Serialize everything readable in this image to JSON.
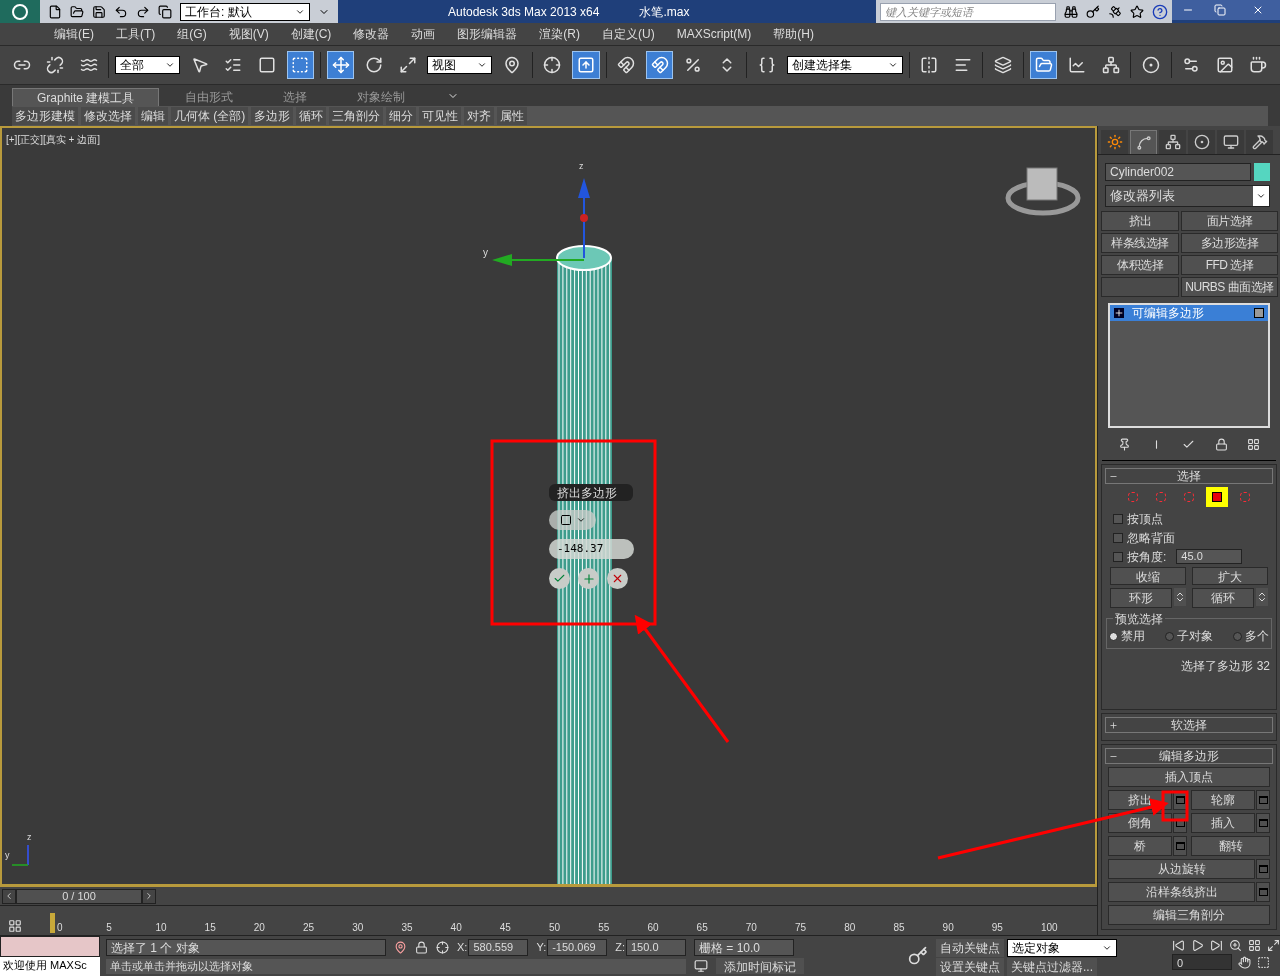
{
  "title_bar": {
    "workspace": "工作台: 默认",
    "app_title": "Autodesk 3ds Max  2013 x64",
    "file_name": "水笔.max",
    "search": {
      "placeholder": "键入关键字或短语"
    }
  },
  "menu": [
    "编辑(E)",
    "工具(T)",
    "组(G)",
    "视图(V)",
    "创建(C)",
    "修改器",
    "动画",
    "图形编辑器",
    "渲染(R)",
    "自定义(U)",
    "MAXScript(M)",
    "帮助(H)"
  ],
  "main_toolbar": [
    {
      "kind": "button",
      "active": false
    },
    {
      "kind": "button",
      "active": false
    },
    {
      "kind": "button",
      "active": false
    },
    {
      "kind": "sep"
    },
    {
      "kind": "dropdown",
      "value": "全部"
    },
    {
      "kind": "button",
      "active": false
    },
    {
      "kind": "button",
      "active": false
    },
    {
      "kind": "button",
      "active": false
    },
    {
      "kind": "button",
      "active": true
    },
    {
      "kind": "sep"
    },
    {
      "kind": "button",
      "active": true
    },
    {
      "kind": "button",
      "active": false
    },
    {
      "kind": "button",
      "active": false
    },
    {
      "kind": "dropdown",
      "value": "视图"
    },
    {
      "kind": "button",
      "active": false
    },
    {
      "kind": "sep"
    },
    {
      "kind": "button",
      "active": false
    },
    {
      "kind": "button",
      "active": true
    },
    {
      "kind": "sep"
    },
    {
      "kind": "button",
      "active": false
    },
    {
      "kind": "button",
      "active": true
    },
    {
      "kind": "button",
      "active": false
    },
    {
      "kind": "button",
      "active": false
    },
    {
      "kind": "sep"
    },
    {
      "kind": "button",
      "active": false
    },
    {
      "kind": "dropdown",
      "value": "创建选择集"
    },
    {
      "kind": "sep"
    },
    {
      "kind": "button",
      "active": false
    },
    {
      "kind": "button",
      "active": false
    },
    {
      "kind": "sep"
    },
    {
      "kind": "button",
      "active": false
    },
    {
      "kind": "sep"
    },
    {
      "kind": "button",
      "active": true
    },
    {
      "kind": "button",
      "active": false
    },
    {
      "kind": "button",
      "active": false
    },
    {
      "kind": "sep"
    },
    {
      "kind": "button",
      "active": false
    },
    {
      "kind": "sep"
    },
    {
      "kind": "button",
      "active": false
    },
    {
      "kind": "button",
      "active": false
    },
    {
      "kind": "button",
      "active": false
    }
  ],
  "ribbon": {
    "tabs": [
      {
        "label": "Graphite 建模工具",
        "selected": true
      },
      {
        "label": "自由形式",
        "selected": false
      },
      {
        "label": "选择",
        "selected": false
      },
      {
        "label": "对象绘制",
        "selected": false
      }
    ],
    "panels": [
      "多边形建模",
      "修改选择",
      "编辑",
      "几何体 (全部)",
      "多边形",
      "循环",
      "三角剖分",
      "细分",
      "可见性",
      "对齐",
      "属性"
    ]
  },
  "viewport": {
    "label": "[+][正交][真实 + 边面]",
    "gizmo_axes": [
      "z",
      "y"
    ],
    "corner_axes": [
      "z",
      "y"
    ],
    "caddy": {
      "title": "挤出多边形",
      "value": "-148.37"
    }
  },
  "command_panel": {
    "tabs": [
      {
        "selected": false
      },
      {
        "selected": true
      },
      {
        "selected": false
      },
      {
        "selected": false
      },
      {
        "selected": false
      },
      {
        "selected": false
      }
    ],
    "object_name": "Cylinder002",
    "modifier_list": "修改器列表",
    "modifier_buttons": [
      {
        "kind": "label",
        "label": "挤出"
      },
      {
        "kind": "label",
        "label": "面片选择"
      },
      {
        "kind": "label",
        "label": "样条线选择"
      },
      {
        "kind": "label",
        "label": "多边形选择"
      },
      {
        "kind": "label",
        "label": "体积选择"
      },
      {
        "kind": "label",
        "label": "FFD 选择"
      },
      {
        "kind": "blank"
      },
      {
        "kind": "label",
        "label": "NURBS 曲面选择"
      }
    ],
    "stack": [
      {
        "label": "可编辑多边形",
        "selected": true
      }
    ],
    "selection": {
      "title": "选择",
      "expanded": true,
      "levels": [
        {
          "selected": false
        },
        {
          "selected": false
        },
        {
          "selected": false
        },
        {
          "selected": true
        },
        {
          "selected": false
        }
      ],
      "checks": [
        {
          "label": "按顶点",
          "checked": false
        },
        {
          "label": "忽略背面",
          "checked": false
        },
        {
          "label": "按角度:",
          "checked": false,
          "value": "45.0"
        }
      ],
      "buttons": [
        {
          "label": "收缩",
          "spinner": false
        },
        {
          "label": "扩大",
          "spinner": false
        },
        {
          "label": "环形",
          "spinner": true
        },
        {
          "label": "循环",
          "spinner": true
        }
      ],
      "preview": {
        "title": "预览选择",
        "options": [
          {
            "label": "禁用",
            "selected": true
          },
          {
            "label": "子对象",
            "selected": false
          },
          {
            "label": "多个",
            "selected": false
          }
        ]
      },
      "status": "选择了多边形 32"
    },
    "soft_selection": {
      "title": "软选择",
      "expanded": false
    },
    "edit_polygons": {
      "title": "编辑多边形",
      "expanded": true,
      "rows": [
        [
          {
            "label": "插入顶点",
            "settings": false
          }
        ],
        [
          {
            "label": "挤出",
            "settings": true
          },
          {
            "label": "轮廓",
            "settings": true
          }
        ],
        [
          {
            "label": "倒角",
            "settings": true
          },
          {
            "label": "插入",
            "settings": true
          }
        ],
        [
          {
            "label": "桥",
            "settings": true
          },
          {
            "label": "翻转",
            "settings": false
          }
        ],
        [
          {
            "label": "从边旋转",
            "settings": true
          }
        ],
        [
          {
            "label": "沿样条线挤出",
            "settings": true
          }
        ],
        [
          {
            "label": "编辑三角剖分",
            "settings": false
          }
        ]
      ]
    }
  },
  "time_slider": {
    "label": "0 / 100",
    "ticks": [
      "0",
      "5",
      "10",
      "15",
      "20",
      "25",
      "30",
      "35",
      "40",
      "45",
      "50",
      "55",
      "60",
      "65",
      "70",
      "75",
      "80",
      "85",
      "90",
      "95",
      "100"
    ]
  },
  "status_bar": {
    "listener": "欢迎使用 MAXSc",
    "selection": "选择了 1 个 对象",
    "prompt": "单击或单击并拖动以选择对象",
    "coords": [
      {
        "label": "X:",
        "value": "580.559"
      },
      {
        "label": "Y:",
        "value": "-150.069"
      },
      {
        "label": "Z:",
        "value": "150.0"
      }
    ],
    "grid": "栅格 = 10.0",
    "add_tag": "添加时间标记",
    "auto_key": "自动关键点",
    "set_key": "设置关键点",
    "key_mode": "选定对象",
    "key_filters": "关键点过滤器...",
    "frame": "0"
  }
}
